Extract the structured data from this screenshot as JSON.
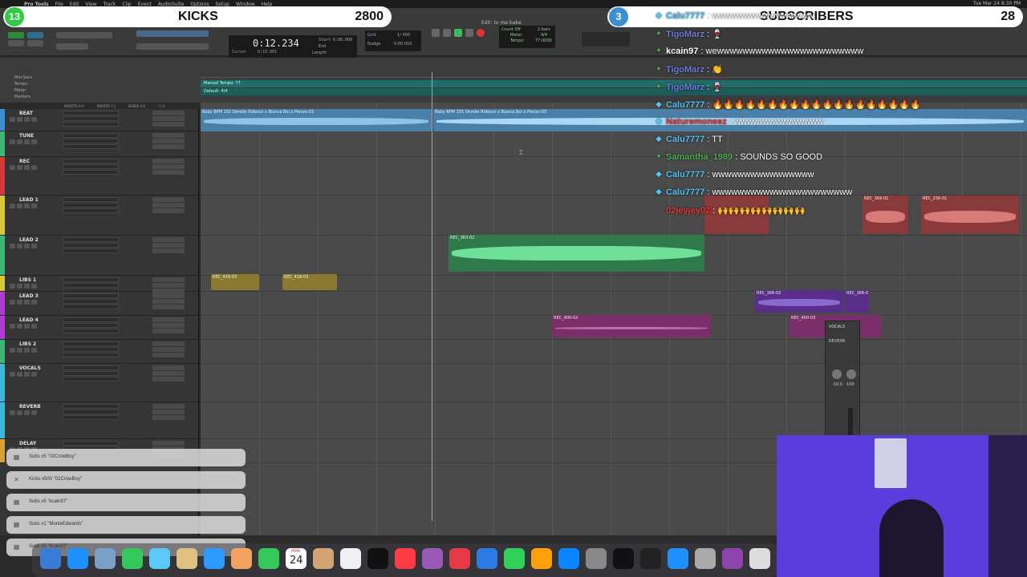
{
  "menubar": {
    "app": "Pro Tools",
    "items": [
      "File",
      "Edit",
      "View",
      "Track",
      "Clip",
      "Event",
      "AudioSuite",
      "Options",
      "Setup",
      "Window",
      "Help"
    ],
    "clock": "Tue Mar 24  8:30 PM"
  },
  "edit_window_title": "Edit: to me babe",
  "counter": {
    "main": "0:12.234",
    "cursor_label": "Cursor",
    "cursor_value": "0:10.981",
    "start_label": "Start",
    "start_value": "0:00.000",
    "end_label": "End",
    "length_label": "Length",
    "grid_label": "Grid",
    "nudge_label": "Nudge",
    "grid_value": "1/ 000",
    "nudge_value": "0:00.010"
  },
  "tempo": {
    "count_off": "Count Off",
    "bars": "2 bars",
    "meter": "Meter",
    "meter_value": "4/4",
    "tempo_label": "Tempo",
    "tempo_value": "77.0000"
  },
  "ruler_labels": [
    "Min:Secs",
    "Tempo",
    "Meter",
    "Markers"
  ],
  "tempo_marker": "Manual Tempo: 77",
  "meter_marker": "Default: 4/4",
  "column_headers": [
    "INSERTS A-E",
    "INSERTS F-J",
    "SENDS A-E",
    "I / O"
  ],
  "tracks": [
    {
      "name": "BEAT",
      "color": "#3b8fd6"
    },
    {
      "name": "TUNE",
      "color": "#3cb878"
    },
    {
      "name": "REC",
      "color": "#d63a3a"
    },
    {
      "name": "LEAD 1",
      "color": "#d6c83a"
    },
    {
      "name": "LEAD 2",
      "color": "#3cb878"
    },
    {
      "name": "LIBS 1",
      "color": "#d6c83a"
    },
    {
      "name": "LEAD 3",
      "color": "#b43ad6"
    },
    {
      "name": "LEAD 4",
      "color": "#b43ad6"
    },
    {
      "name": "LIBS 2",
      "color": "#3cb878"
    },
    {
      "name": "VOCALS",
      "color": "#3ab8d6"
    },
    {
      "name": "REVERB",
      "color": "#3ab8d6"
    },
    {
      "name": "DELAY",
      "color": "#d6a03a"
    }
  ],
  "clips": {
    "beat_1": "Baby BPM 155 Derelle Rideout x Bianca Boi x Pieces-03",
    "beat_2": "Baby BPM 155 Derelle Rideout x Bianca Boi x Pieces-03",
    "lead2": "REC_363-02",
    "libs1_a": "REC_418-03",
    "libs1_b": "REC_418-03",
    "lead1_a": "REC_369-01",
    "lead1_b": "REC_236-01",
    "lead3_a": "REC_366-02",
    "lead3_b": "REC_366-0",
    "lead4_a": "REC_400-02",
    "lead4_b": "REC_400-03"
  },
  "overlay": {
    "kicks": {
      "badge": "13",
      "label": "KICKS",
      "value": "2800",
      "badge_color": "#2ecc40"
    },
    "subs": {
      "badge": "3",
      "label": "SUBSCRIBERS",
      "value": "28",
      "badge_color": "#3a8fd6"
    }
  },
  "chat": [
    {
      "user": "Calu7777",
      "text": "wwwwwwwwwwwwwwww",
      "color": "#4fc3f7",
      "icon": "diamond-icon"
    },
    {
      "user": "TigoMarz",
      "text": "🍷",
      "color": "#6e7bd9",
      "icon": "star-icon"
    },
    {
      "user": "kcain97",
      "text": "wewwwwwwwwwwwwwwwwwwwwwww",
      "color": "#ffffff",
      "icon": "star-icon"
    },
    {
      "user": "TigoMarz",
      "text": "👏",
      "color": "#6e7bd9",
      "icon": "star-icon"
    },
    {
      "user": "TigoMarz",
      "text": "🍷",
      "color": "#6e7bd9",
      "icon": "star-icon"
    },
    {
      "user": "Calu7777",
      "text": "🔥🔥🔥🔥🔥🔥🔥🔥🔥🔥🔥🔥🔥🔥🔥🔥🔥🔥🔥",
      "color": "#4fc3f7",
      "icon": "diamond-icon"
    },
    {
      "user": "Naturemoneez",
      "text": "wwwwwwwwwwwwww",
      "color": "#e03a3a",
      "icon": "diamond-icon"
    },
    {
      "user": "Calu7777",
      "text": "TT",
      "color": "#4fc3f7",
      "icon": "diamond-icon"
    },
    {
      "user": "Samantha_1989",
      "text": "SOUNDS SO GOOD",
      "color": "#4caf50",
      "icon": "star-icon"
    },
    {
      "user": "Calu7777",
      "text": "wwwwwwwwwwwwwwww",
      "color": "#4fc3f7",
      "icon": "diamond-icon"
    },
    {
      "user": "Calu7777",
      "text": "wwwwwwwwwwwwwwwwwwwwww",
      "color": "#4fc3f7",
      "icon": "diamond-icon"
    },
    {
      "user": "02jeyjey02",
      "text": "🙌🙌🙌🙌🙌🙌🙌🙌",
      "color": "#e03a3a",
      "icon": "none"
    }
  ],
  "notifications": [
    {
      "text": "Subs x5 \"02CrowBoy\""
    },
    {
      "text": "Kicks x500 \"02CrowBoy\""
    },
    {
      "text": "Subs x5 \"kcain97\""
    },
    {
      "text": "Subs x1 \"MonieEdwards\""
    },
    {
      "text": "Subs x5 \"kcain97\""
    }
  ],
  "dock_date": {
    "month": "MAR",
    "day": "24"
  },
  "mixer": {
    "name": "VOCALS",
    "insert": "REVERB",
    "vol": "-10.0",
    "pan": "100"
  }
}
